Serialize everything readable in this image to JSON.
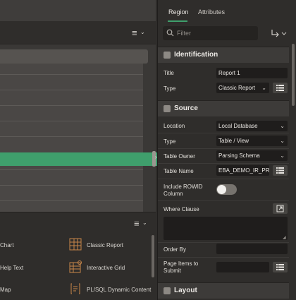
{
  "right_panel": {
    "tabs": {
      "region": "Region",
      "attributes": "Attributes"
    },
    "filter": {
      "placeholder": "Filter"
    },
    "sections": {
      "identification": {
        "title": "Identification",
        "fields": {
          "title": {
            "label": "Title",
            "value": "Report 1"
          },
          "type": {
            "label": "Type",
            "value": "Classic Report"
          }
        }
      },
      "source": {
        "title": "Source",
        "fields": {
          "location": {
            "label": "Location",
            "value": "Local Database"
          },
          "type": {
            "label": "Type",
            "value": "Table / View"
          },
          "table_owner": {
            "label": "Table Owner",
            "value": "Parsing Schema"
          },
          "table_name": {
            "label": "Table Name",
            "value": "EBA_DEMO_IR_PRO"
          },
          "include_rowid": {
            "label": "Include ROWID Column",
            "enabled": false
          },
          "where_clause": {
            "label": "Where Clause",
            "value": ""
          },
          "order_by": {
            "label": "Order By",
            "value": ""
          },
          "page_items": {
            "label": "Page Items to Submit",
            "value": ""
          }
        }
      },
      "layout": {
        "title": "Layout"
      }
    }
  },
  "gallery": {
    "items": [
      {
        "label": "Chart",
        "icon": "chart-icon"
      },
      {
        "label": "Classic Report",
        "icon": "classic-report-icon"
      },
      {
        "label": "Help Text",
        "icon": "help-text-icon"
      },
      {
        "label": "Interactive Grid",
        "icon": "interactive-grid-icon"
      },
      {
        "label": "Map",
        "icon": "map-icon"
      },
      {
        "label": "PL/SQL Dynamic Content",
        "icon": "plsql-dynamic-content-icon"
      }
    ]
  },
  "colors": {
    "accent_green": "#3f9f6c",
    "panel_bg": "#2f2d2b",
    "field_bg": "#1f1d1c"
  }
}
